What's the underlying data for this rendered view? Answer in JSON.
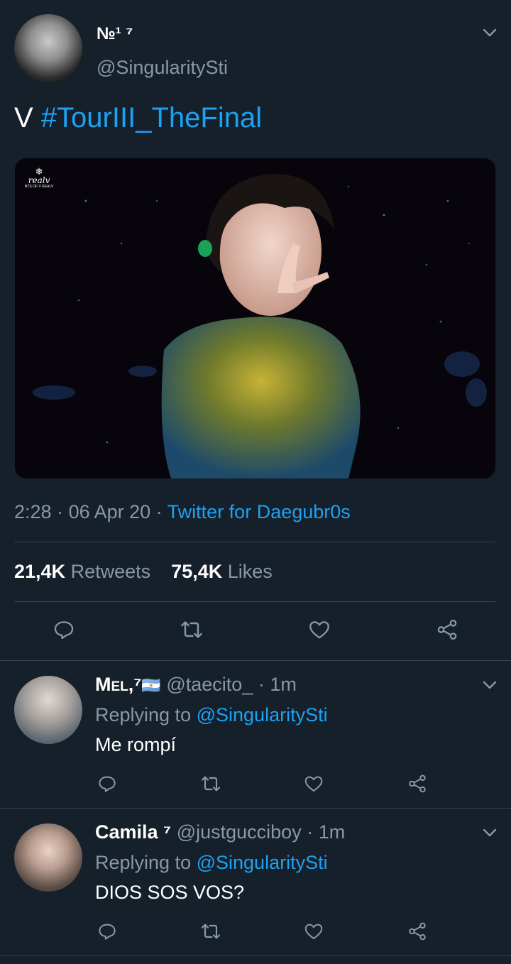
{
  "main_tweet": {
    "display_name": "№¹ ⁷",
    "handle": "@SingularitySti",
    "text_prefix": "V",
    "hashtag": "#TourIII_TheFinal",
    "image_watermark": "realv",
    "image_watermark_sub": "BTS OF V REALV",
    "time": "2:28",
    "date": "06 Apr 20",
    "source": "Twitter for Daegubr0s",
    "retweets_count": "21,4K",
    "retweets_label": "Retweets",
    "likes_count": "75,4K",
    "likes_label": "Likes"
  },
  "replies": [
    {
      "display_name": "Mel,⁷",
      "flag": "🇦🇷",
      "handle": "@taecito_",
      "time": "· 1m",
      "replying_prefix": "Replying to",
      "replying_to": "@SingularitySti",
      "text": "Me rompí"
    },
    {
      "display_name": "Camila ⁷",
      "handle": "@justgucciboy",
      "time": "· 1m",
      "replying_prefix": "Replying to",
      "replying_to": "@SingularitySti",
      "text": "DIOS SOS VOS?"
    }
  ],
  "icons": {
    "reply": "reply-icon",
    "retweet": "retweet-icon",
    "like": "heart-icon",
    "share": "share-icon",
    "more": "chevron-down-icon"
  },
  "colors": {
    "background": "#15202b",
    "accent": "#1da1f2",
    "muted": "#8899a6",
    "divider": "#38444d"
  }
}
